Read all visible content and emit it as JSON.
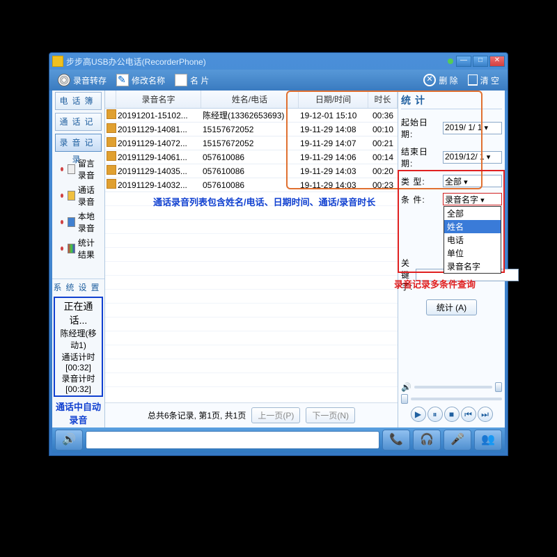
{
  "title": "步步高USB办公电话(RecorderPhone)",
  "toolbar": {
    "save": "录音转存",
    "rename": "修改名称",
    "card": "名 片",
    "delete": "删 除",
    "clear": "清 空"
  },
  "nav": {
    "phonebook": "电话簿",
    "calllog": "通话记录",
    "reclog": "录音记录"
  },
  "tree": {
    "msg": "留言录音",
    "call": "通话录音",
    "local": "本地录音",
    "stat": "统计结果"
  },
  "columns": {
    "name": "录音名字",
    "contact": "姓名/电话",
    "datetime": "日期/时间",
    "duration": "时长"
  },
  "rows": [
    {
      "name": "20191201-15102...",
      "contact": "陈经理(13362653693)",
      "dt": "19-12-01 15:10",
      "dur": "00:36"
    },
    {
      "name": "20191129-14081...",
      "contact": "15157672052",
      "dt": "19-11-29 14:08",
      "dur": "00:10"
    },
    {
      "name": "20191129-14072...",
      "contact": "15157672052",
      "dt": "19-11-29 14:07",
      "dur": "00:21"
    },
    {
      "name": "20191129-14061...",
      "contact": "057610086",
      "dt": "19-11-29 14:06",
      "dur": "00:14"
    },
    {
      "name": "20191129-14035...",
      "contact": "057610086",
      "dt": "19-11-29 14:03",
      "dur": "00:20"
    },
    {
      "name": "20191129-14032...",
      "contact": "057610086",
      "dt": "19-11-29 14:03",
      "dur": "00:23"
    }
  ],
  "note_list": "通话录音列表包含姓名/电话、日期时间、通话/录音时长",
  "syslink": "系统设置",
  "callbox": {
    "status": "正在通话...",
    "who": "陈经理(移动1)",
    "t1": "通话计时 [00:32]",
    "t2": "录音计时 [00:32]"
  },
  "autorec": "通话中自动录音",
  "pager": {
    "total": "总共6条记录, 第1页, 共1页",
    "prev": "上一页(P)",
    "next": "下一页(N)"
  },
  "stats": {
    "title": "统计",
    "start_label": "起始日期:",
    "start": "2019/ 1/ 1",
    "end_label": "结束日期:",
    "end": "2019/12/ 1",
    "type_label": "类    型:",
    "type": "全部",
    "cond_label": "条    件:",
    "cond": "录音名字",
    "opts": [
      "全部",
      "姓名",
      "电话",
      "单位",
      "录音名字"
    ],
    "kw_label": "关 键 字:",
    "btn": "统计 (A)"
  },
  "note_filter": "录音记录多条件查询"
}
